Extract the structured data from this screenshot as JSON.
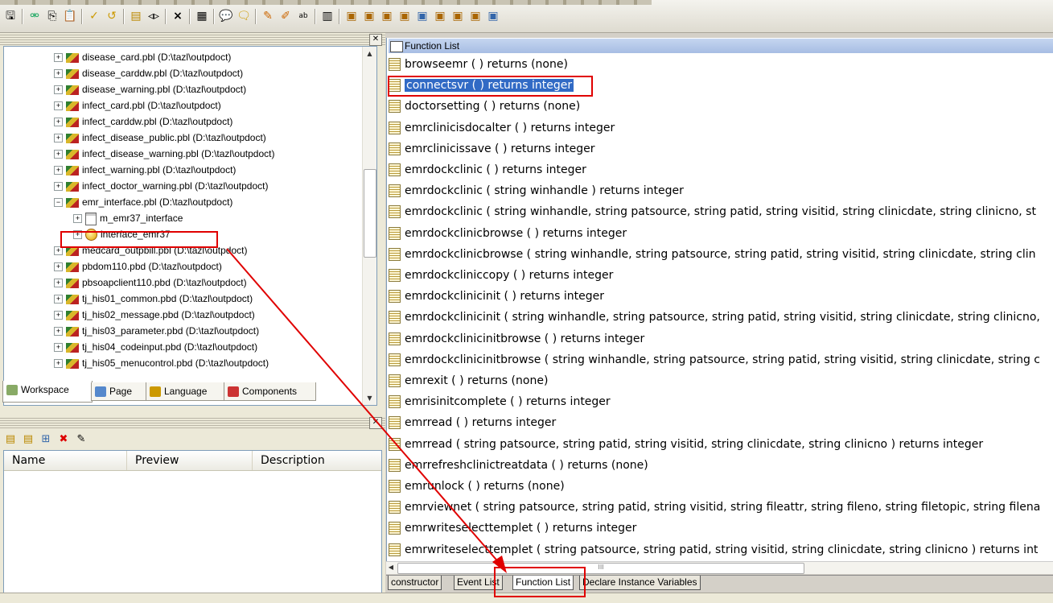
{
  "toolbar": {
    "buttons": [
      "save-icon",
      "inherit-icon",
      "copy-icon",
      "paste-icon",
      "check-icon",
      "uncheck-icon",
      "properties-icon",
      "preview-icon",
      "delete-icon",
      "grid-icon",
      "comment-icon",
      "uncomment-icon",
      "script-icon",
      "debug-icon",
      "abc-icon",
      "layout-icon",
      "library-icon-1",
      "library-icon-2",
      "library-icon-3",
      "library-icon-4",
      "library-icon-5",
      "library-icon-6",
      "library-icon-7",
      "library-icon-8",
      "library-icon-9"
    ],
    "delete_glyph": "×",
    "ab_glyph": "ab"
  },
  "tree": {
    "items": [
      {
        "label": "disease_card.pbl (D:\\tazl\\outpdoct)",
        "indent": 1,
        "icon": "library",
        "exp": "+"
      },
      {
        "label": "disease_carddw.pbl (D:\\tazl\\outpdoct)",
        "indent": 1,
        "icon": "library",
        "exp": "+"
      },
      {
        "label": "disease_warning.pbl (D:\\tazl\\outpdoct)",
        "indent": 1,
        "icon": "library",
        "exp": "+"
      },
      {
        "label": "infect_card.pbl (D:\\tazl\\outpdoct)",
        "indent": 1,
        "icon": "library",
        "exp": "+"
      },
      {
        "label": "infect_carddw.pbl (D:\\tazl\\outpdoct)",
        "indent": 1,
        "icon": "library",
        "exp": "+"
      },
      {
        "label": "infect_disease_public.pbl (D:\\tazl\\outpdoct)",
        "indent": 1,
        "icon": "library",
        "exp": "+"
      },
      {
        "label": "infect_disease_warning.pbl (D:\\tazl\\outpdoct)",
        "indent": 1,
        "icon": "library",
        "exp": "+"
      },
      {
        "label": "infect_warning.pbl (D:\\tazl\\outpdoct)",
        "indent": 1,
        "icon": "library",
        "exp": "+"
      },
      {
        "label": "infect_doctor_warning.pbl (D:\\tazl\\outpdoct)",
        "indent": 1,
        "icon": "library",
        "exp": "+"
      },
      {
        "label": "emr_interface.pbl (D:\\tazl\\outpdoct)",
        "indent": 1,
        "icon": "library",
        "exp": "−"
      },
      {
        "label": "m_emr37_interface",
        "indent": 2,
        "icon": "window",
        "exp": "+"
      },
      {
        "label": "interface_emr37",
        "indent": 2,
        "icon": "nvo",
        "exp": "+"
      },
      {
        "label": "medcard_outpbill.pbl (D:\\tazl\\outpdoct)",
        "indent": 1,
        "icon": "library",
        "exp": "+"
      },
      {
        "label": "pbdom110.pbd (D:\\tazl\\outpdoct)",
        "indent": 1,
        "icon": "library",
        "exp": "+"
      },
      {
        "label": "pbsoapclient110.pbd (D:\\tazl\\outpdoct)",
        "indent": 1,
        "icon": "library",
        "exp": "+"
      },
      {
        "label": "tj_his01_common.pbd (D:\\tazl\\outpdoct)",
        "indent": 1,
        "icon": "library",
        "exp": "+"
      },
      {
        "label": "tj_his02_message.pbd (D:\\tazl\\outpdoct)",
        "indent": 1,
        "icon": "library",
        "exp": "+"
      },
      {
        "label": "tj_his03_parameter.pbd (D:\\tazl\\outpdoct)",
        "indent": 1,
        "icon": "library",
        "exp": "+"
      },
      {
        "label": "tj_his04_codeinput.pbd (D:\\tazl\\outpdoct)",
        "indent": 1,
        "icon": "library",
        "exp": "+"
      },
      {
        "label": "tj_his05_menucontrol.pbd (D:\\tazl\\outpdoct)",
        "indent": 1,
        "icon": "library",
        "exp": "+"
      }
    ]
  },
  "left_tabs": [
    {
      "label": "Workspace",
      "active": true
    },
    {
      "label": "Page",
      "active": false
    },
    {
      "label": "Language",
      "active": false
    },
    {
      "label": "Components",
      "active": false
    }
  ],
  "list_columns": [
    "Name",
    "Preview",
    "Description"
  ],
  "func_panel": {
    "header": "Function List",
    "selected_index": 1,
    "rows": [
      "browseemr ( ) returns (none)",
      "connectsvr ( )  returns integer",
      "doctorsetting ( ) returns (none)",
      "emrclinicisdocalter ( )  returns integer",
      "emrclinicissave ( )  returns integer",
      "emrdockclinic ( )  returns integer",
      "emrdockclinic ( string winhandle )  returns integer",
      "emrdockclinic ( string winhandle, string patsource, string patid, string visitid, string clinicdate, string clinicno, st",
      "emrdockclinicbrowse ( )  returns integer",
      "emrdockclinicbrowse ( string winhandle, string patsource, string patid, string visitid, string clinicdate, string clin",
      "emrdockcliniccopy ( )  returns integer",
      "emrdockclinicinit ( )  returns integer",
      "emrdockclinicinit ( string winhandle, string patsource, string patid, string visitid, string clinicdate, string clinicno,",
      "emrdockclinicinitbrowse ( )  returns integer",
      "emrdockclinicinitbrowse ( string winhandle, string patsource, string patid, string visitid, string clinicdate, string c",
      "emrexit ( ) returns (none)",
      "emrisinitcomplete ( )  returns integer",
      "emrread ( )  returns integer",
      "emrread ( string patsource, string patid, string visitid, string clinicdate, string clinicno )  returns integer",
      "emrrefreshclinictreatdata ( ) returns (none)",
      "emrunlock ( ) returns (none)",
      "emrviewnet ( string patsource, string patid, string visitid, string fileattr, string fileno, string filetopic, string filena",
      "emrwriteselecttemplet ( )  returns integer",
      "emrwriteselecttemplet ( string patsource, string patid, string visitid, string clinicdate, string clinicno )  returns int"
    ],
    "hscroll_grip": "III"
  },
  "bottom_tabs": [
    {
      "label": "constructor",
      "active": false
    },
    {
      "label": "Event List",
      "active": false
    },
    {
      "label": "Function List",
      "active": true
    },
    {
      "label": "Declare Instance Variables",
      "active": false
    }
  ],
  "annotation_color": "#e00000"
}
